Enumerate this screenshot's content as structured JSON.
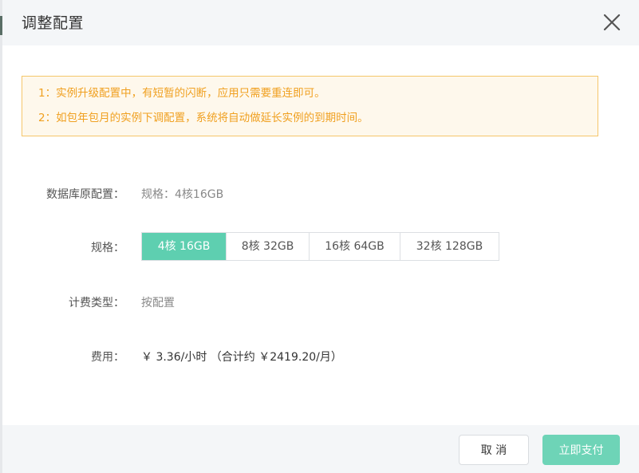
{
  "dialog": {
    "title": "调整配置",
    "close_icon": "close-icon"
  },
  "notice": {
    "line1": "1：实例升级配置中，有短暂的闪断，应用只需要重连即可。",
    "line2": "2：如包年包月的实例下调配置，系统将自动做延长实例的到期时间。",
    "text_color": "#f0a020",
    "border_color": "#f5c66a",
    "background": "#fef8ec"
  },
  "form": {
    "original_config": {
      "label": "数据库原配置：",
      "value": "规格：4核16GB"
    },
    "spec": {
      "label": "规格：",
      "options": [
        {
          "label": "4核 16GB",
          "selected": true
        },
        {
          "label": "8核 32GB",
          "selected": false
        },
        {
          "label": "16核 64GB",
          "selected": false
        },
        {
          "label": "32核 128GB",
          "selected": false
        }
      ]
    },
    "billing_type": {
      "label": "计费类型：",
      "value": "按配置"
    },
    "fee": {
      "label": "费用：",
      "value": "￥ 3.36/小时 （合计约 ￥2419.20/月）"
    }
  },
  "footer": {
    "cancel_label": "取 消",
    "pay_label": "立即支付"
  },
  "colors": {
    "accent": "#5ecfb0",
    "pay_button": "#6ed4b7",
    "header_bg": "#f4f6f8"
  }
}
